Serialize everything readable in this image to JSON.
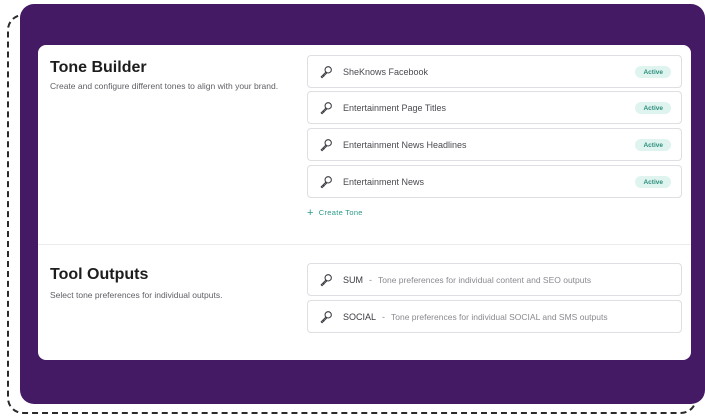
{
  "tone_builder": {
    "title": "Tone Builder",
    "description": "Create and configure different tones to align with your brand.",
    "tones": [
      {
        "name": "SheKnows Facebook",
        "status": "Active"
      },
      {
        "name": "Entertainment Page Titles",
        "status": "Active"
      },
      {
        "name": "Entertainment News Headlines",
        "status": "Active"
      },
      {
        "name": "Entertainment News",
        "status": "Active"
      }
    ],
    "create_label": "Create Tone",
    "create_icon": "plus-icon"
  },
  "tool_outputs": {
    "title": "Tool Outputs",
    "description": "Select tone preferences for individual outputs.",
    "separator": "-",
    "outputs": [
      {
        "name": "SUM",
        "description": "Tone preferences for individual content and SEO outputs"
      },
      {
        "name": "SOCIAL",
        "description": "Tone preferences for individual SOCIAL and SMS outputs"
      }
    ]
  },
  "icons": {
    "tone_icon": "microphone-icon"
  },
  "colors": {
    "panel": "#431a63",
    "accent": "#2b9a86",
    "badge_bg": "#dff3ef",
    "badge_text": "#2b8e7c"
  }
}
